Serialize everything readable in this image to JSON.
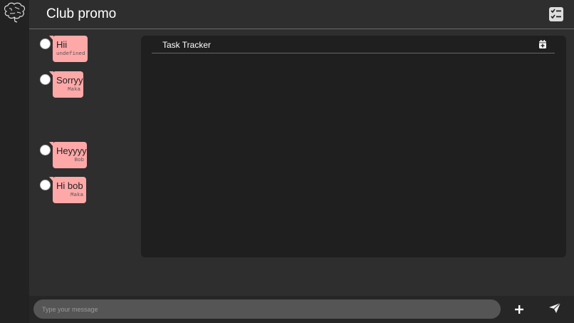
{
  "app": {
    "logo_icon": "brain-icon"
  },
  "header": {
    "title": "Club promo",
    "checklist_icon": "checklist-icon"
  },
  "messages": [
    {
      "text": "Hii",
      "sender": "undefined"
    },
    {
      "text": "Sorryy",
      "sender": "Maka"
    },
    {
      "text": "Heyyyy",
      "sender": "Bob"
    },
    {
      "text": "Hi bob",
      "sender": "Maka"
    }
  ],
  "task_panel": {
    "title": "Task Tracker",
    "icon": "calendar-add-icon"
  },
  "composer": {
    "placeholder": "Type your message",
    "add_icon": "plus-icon",
    "send_icon": "paper-plane-icon"
  },
  "colors": {
    "bubble": "#ffa8a8",
    "background": "#2e2e2e",
    "panel": "#1f1f1f",
    "rail": "#222222"
  }
}
